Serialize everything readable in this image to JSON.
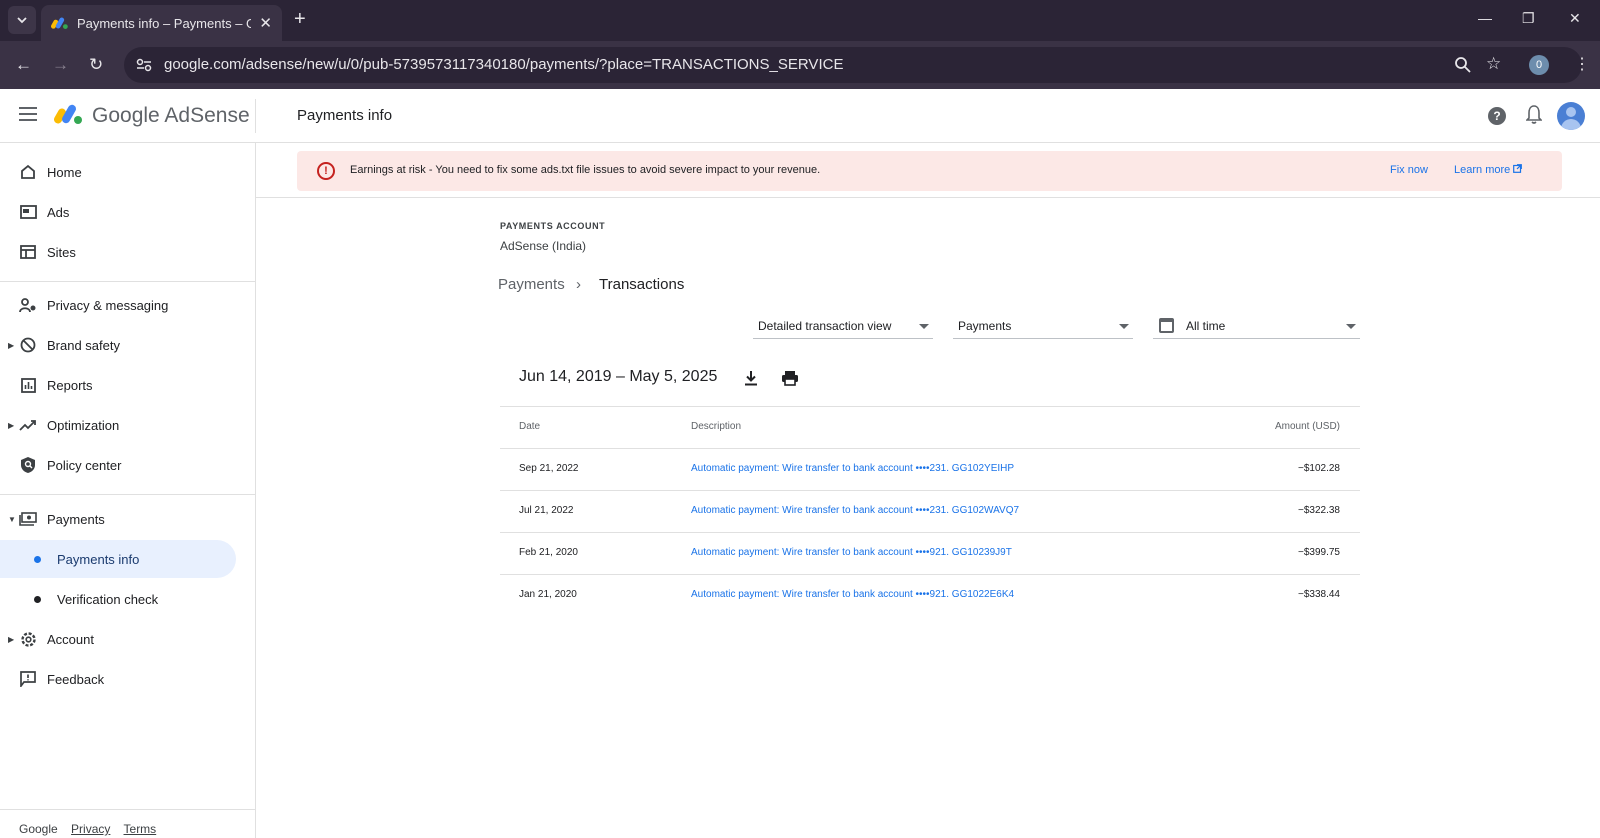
{
  "browser": {
    "tab_title": "Payments info – Payments – Go",
    "tab_close": "✕",
    "new_tab": "+",
    "url": "google.com/adsense/new/u/0/pub-5739573117340180/payments/?place=TRANSACTIONS_SERVICE",
    "profile_initial": "0",
    "window_controls": [
      "—",
      "❐",
      "✕"
    ]
  },
  "header": {
    "logo_text_google": "Google",
    "logo_text_product": "AdSense",
    "page_title": "Payments info",
    "help": "?"
  },
  "sidebar": {
    "items": [
      {
        "label": "Home",
        "icon": "home-icon"
      },
      {
        "label": "Ads",
        "icon": "ads-icon"
      },
      {
        "label": "Sites",
        "icon": "sites-icon"
      },
      {
        "label": "Privacy & messaging",
        "icon": "privacy-icon"
      },
      {
        "label": "Brand safety",
        "icon": "block-icon"
      },
      {
        "label": "Reports",
        "icon": "reports-icon"
      },
      {
        "label": "Optimization",
        "icon": "trending-icon"
      },
      {
        "label": "Policy center",
        "icon": "policy-icon"
      },
      {
        "label": "Payments",
        "icon": "payments-icon"
      },
      {
        "label": "Payments info"
      },
      {
        "label": "Verification check"
      },
      {
        "label": "Account",
        "icon": "settings-icon"
      },
      {
        "label": "Feedback",
        "icon": "feedback-icon"
      }
    ],
    "footer": {
      "google": "Google",
      "privacy": "Privacy",
      "terms": "Terms"
    }
  },
  "alert": {
    "text": "Earnings at risk - You need to fix some ads.txt file issues to avoid severe impact to your revenue.",
    "fix_now": "Fix now",
    "learn_more": "Learn more"
  },
  "account": {
    "label": "PAYMENTS ACCOUNT",
    "name": "AdSense (India)"
  },
  "breadcrumb": {
    "parent": "Payments",
    "separator": "›",
    "current": "Transactions"
  },
  "filters": {
    "view": "Detailed transaction view",
    "type": "Payments",
    "period": "All time"
  },
  "range": "Jun 14, 2019 – May 5, 2025",
  "table": {
    "headers": {
      "date": "Date",
      "description": "Description",
      "amount": "Amount (USD)"
    },
    "rows": [
      {
        "date": "Sep 21, 2022",
        "description": "Automatic payment: Wire transfer to bank account ••••231. GG102YEIHP",
        "amount": "−$102.28"
      },
      {
        "date": "Jul 21, 2022",
        "description": "Automatic payment: Wire transfer to bank account ••••231. GG102WAVQ7",
        "amount": "−$322.38"
      },
      {
        "date": "Feb 21, 2020",
        "description": "Automatic payment: Wire transfer to bank account ••••921. GG10239J9T",
        "amount": "−$399.75"
      },
      {
        "date": "Jan 21, 2020",
        "description": "Automatic payment: Wire transfer to bank account ••••921. GG1022E6K4",
        "amount": "−$338.44"
      }
    ]
  }
}
